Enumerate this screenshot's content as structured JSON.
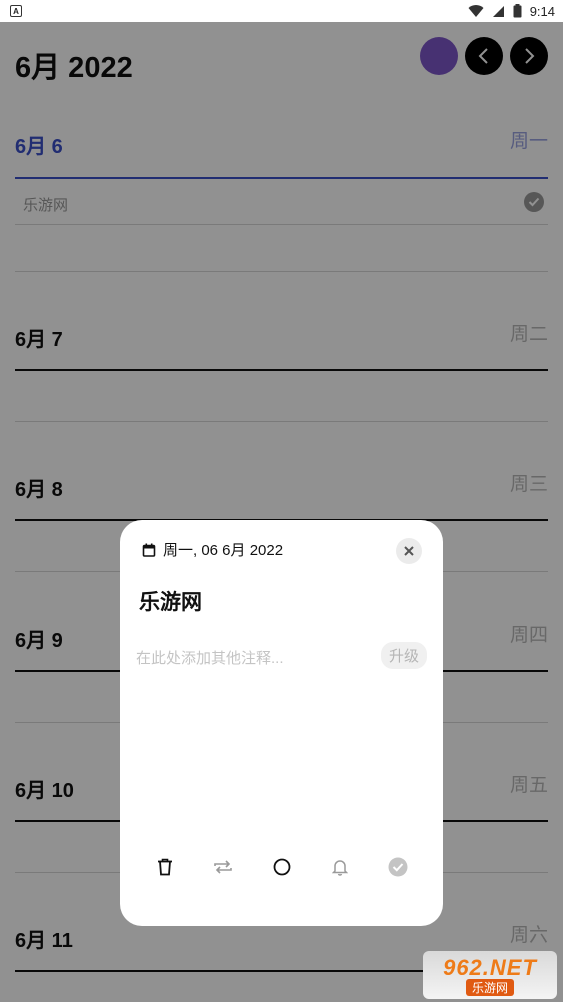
{
  "status_bar": {
    "time": "9:14",
    "app_badge": "A"
  },
  "header": {
    "month_title": "6月 2022"
  },
  "days": [
    {
      "label": "6月 6",
      "weekday": "周一",
      "today": true,
      "tasks": [
        {
          "text": "乐游网",
          "done": true
        }
      ]
    },
    {
      "label": "6月 7",
      "weekday": "周二"
    },
    {
      "label": "6月 8",
      "weekday": "周三"
    },
    {
      "label": "6月 9",
      "weekday": "周四"
    },
    {
      "label": "6月 10",
      "weekday": "周五"
    },
    {
      "label": "6月 11",
      "weekday": "周六"
    }
  ],
  "dialog": {
    "date_text": "周一, 06 6月 2022",
    "title": "乐游网",
    "note_placeholder": "在此处添加其他注释...",
    "upgrade_label": "升级",
    "toolbar": [
      "delete-icon",
      "repeat-icon",
      "circle-icon",
      "bell-icon",
      "check-circle-icon"
    ]
  },
  "watermark": {
    "top": "962.NET",
    "bottom": "乐游网"
  },
  "colors": {
    "accent": "#3a4fc9",
    "avatar": "#7e56c8",
    "watermark": "#ee7b18"
  }
}
